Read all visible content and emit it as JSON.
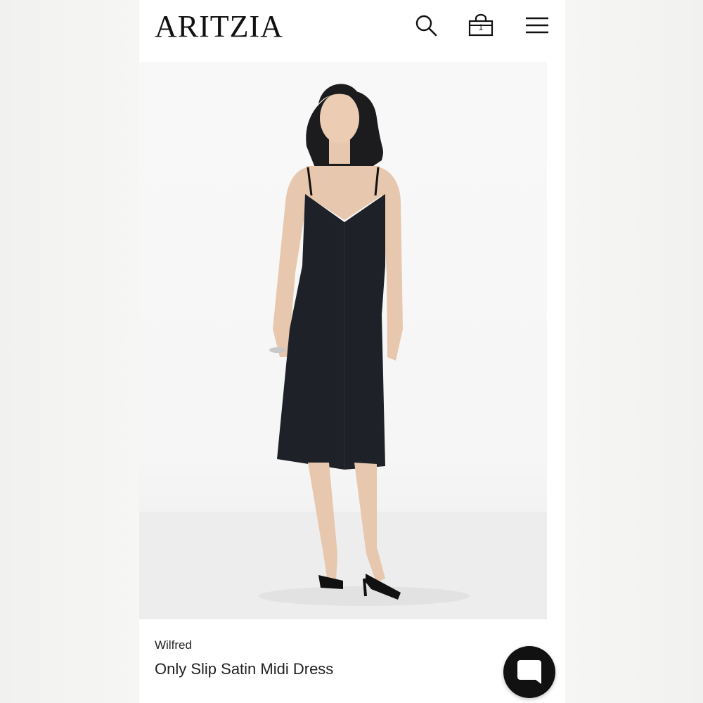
{
  "header": {
    "logo_text": "ARITZIA",
    "search_icon": "search-icon",
    "bag_icon": "shopping-bag-icon",
    "bag_count": "1",
    "menu_icon": "hamburger-menu-icon"
  },
  "product": {
    "brand": "Wilfred",
    "name": "Only Slip Satin Midi Dress",
    "image_icon": "product-photo"
  },
  "chat": {
    "icon": "chat-bubble-icon"
  },
  "colors": {
    "background": "#ffffff",
    "page_backdrop": "#f4f4f3",
    "text": "#222222",
    "chat_button": "#111111"
  }
}
